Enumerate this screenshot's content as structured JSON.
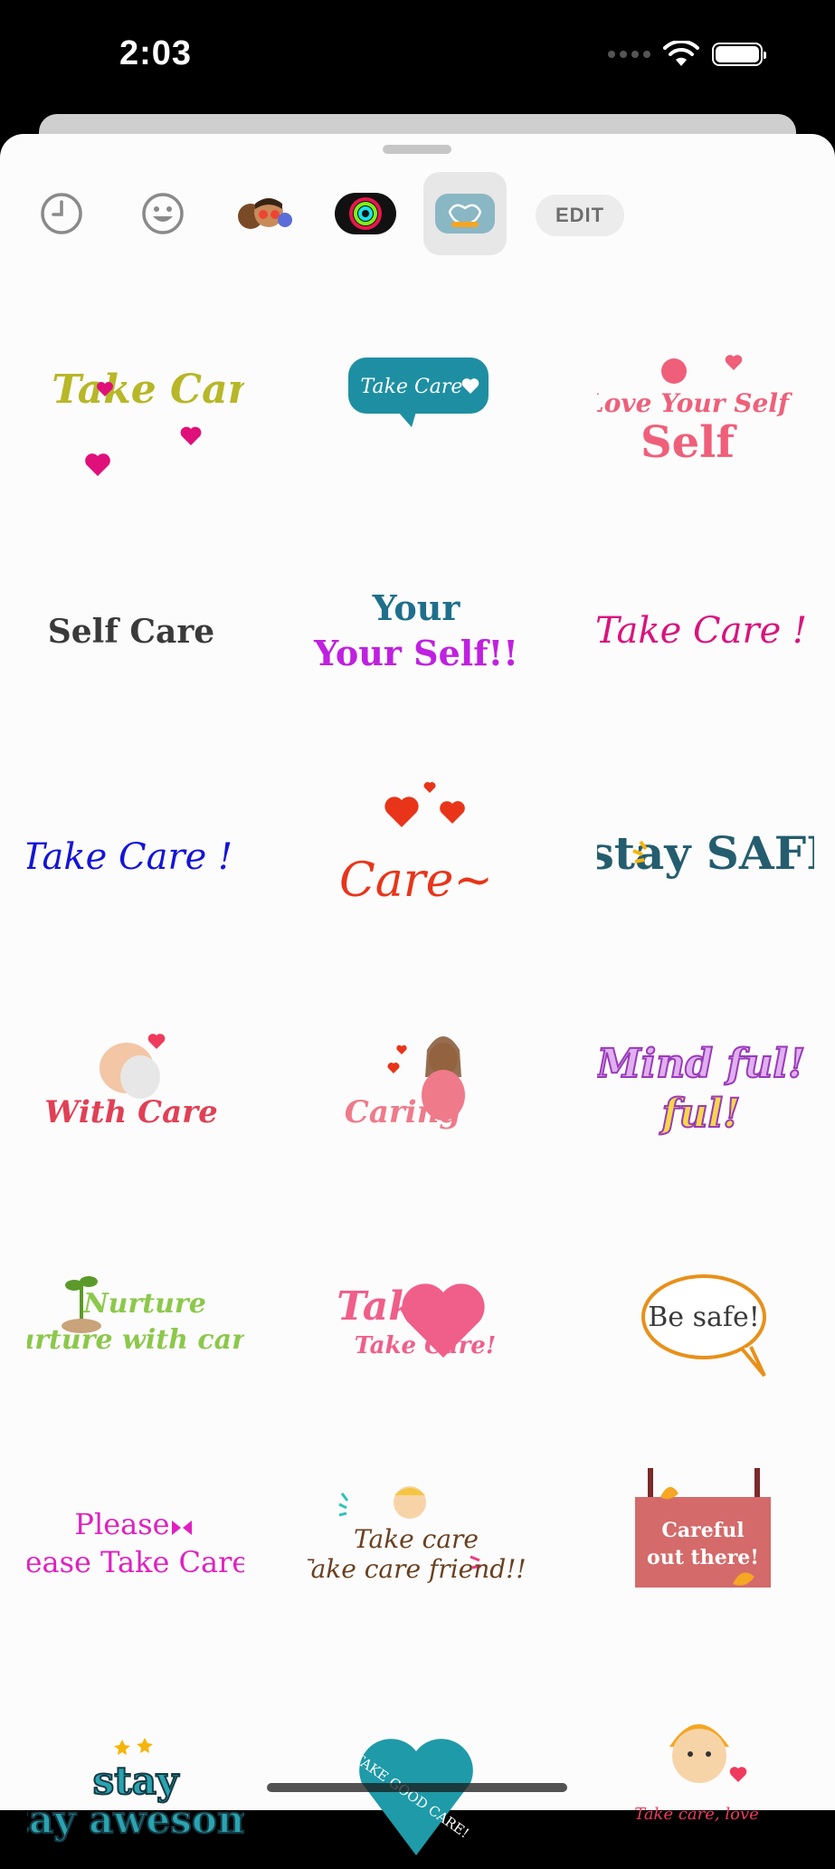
{
  "status_bar": {
    "time": "2:03"
  },
  "toolbar": {
    "edit_label": "EDIT"
  },
  "stickers": [
    {
      "text": "Take Care"
    },
    {
      "text": "Take Care"
    },
    {
      "text": "Love Your Self"
    },
    {
      "text": "Self Care"
    },
    {
      "text": "Your Self!!"
    },
    {
      "text": "Take Care !"
    },
    {
      "text": "Take Care !"
    },
    {
      "text": "Care~"
    },
    {
      "text": "stay SAFE"
    },
    {
      "text": "With Care"
    },
    {
      "text": "Caring"
    },
    {
      "text": "Mind ful!"
    },
    {
      "text": "Nurture with care"
    },
    {
      "text": "Take Care!"
    },
    {
      "text": "Be safe!"
    },
    {
      "text": "Please Take Care!"
    },
    {
      "text": "Take care friend!!!"
    },
    {
      "text": "Careful out there!"
    },
    {
      "text": "stay awesome"
    },
    {
      "text": "TAKE GOOD CARE!"
    },
    {
      "text": "Take care, love"
    }
  ]
}
